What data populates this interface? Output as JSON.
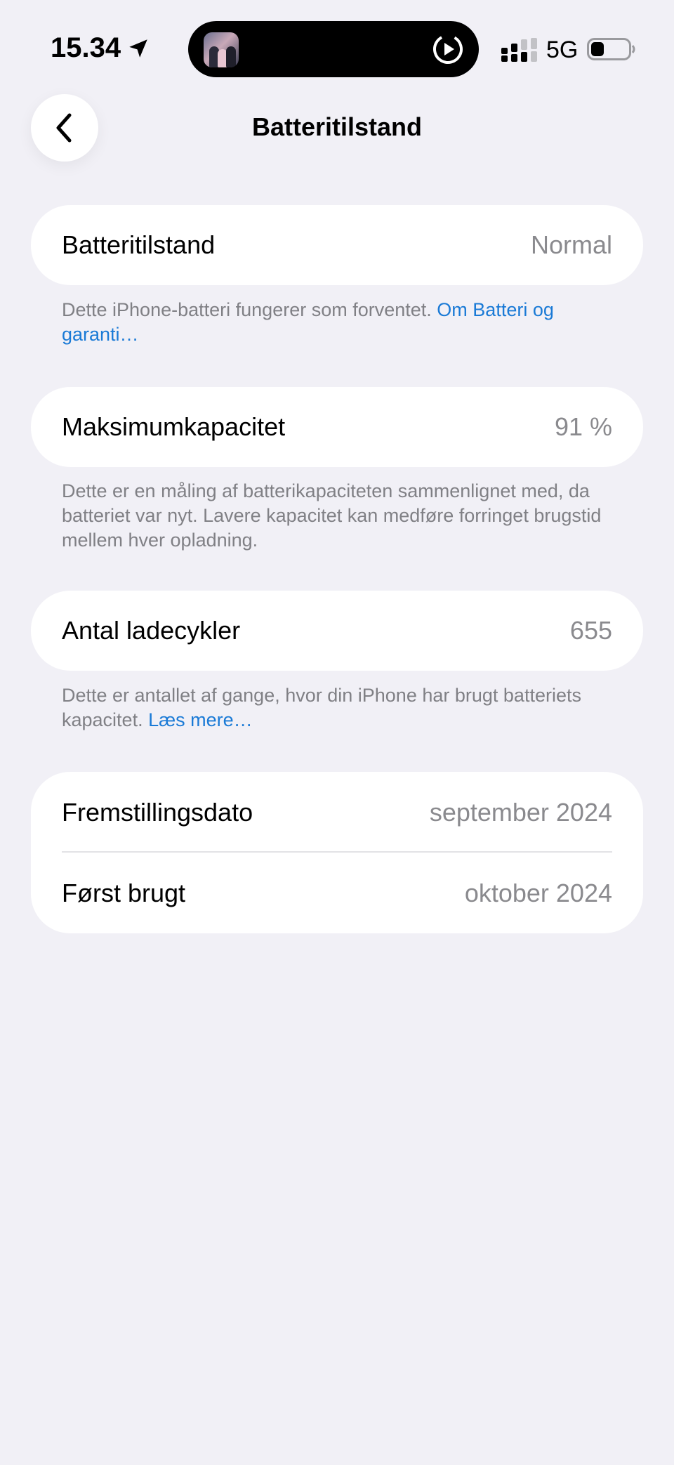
{
  "status_bar": {
    "time": "15.34",
    "network": "5G",
    "location_icon": "location-arrow-icon",
    "play_icon": "play-circle-icon",
    "battery_level": 0.35
  },
  "nav": {
    "title": "Batteritilstand",
    "back_icon": "chevron-left-icon"
  },
  "sections": {
    "health": {
      "label": "Batteritilstand",
      "value": "Normal",
      "footnote": "Dette iPhone-batteri fungerer som forventet.",
      "link": "Om Batteri og garanti…"
    },
    "capacity": {
      "label": "Maksimumkapacitet",
      "value": "91 %",
      "footnote": "Dette er en måling af batterikapaciteten sammenlignet med, da batteriet var nyt. Lavere kapacitet kan medføre forringet brugstid mellem hver opladning."
    },
    "cycles": {
      "label": "Antal ladecykler",
      "value": "655",
      "footnote": "Dette er antallet af gange, hvor din iPhone har brugt batteriets kapacitet.",
      "link": "Læs mere…"
    },
    "dates": {
      "manufactured_label": "Fremstillingsdato",
      "manufactured_value": "september 2024",
      "first_used_label": "Først brugt",
      "first_used_value": "oktober 2024"
    }
  },
  "colors": {
    "background": "#F1F0F6",
    "card": "#FFFFFF",
    "link": "#1A7AD6",
    "secondary_text": "#8A8A8E"
  }
}
